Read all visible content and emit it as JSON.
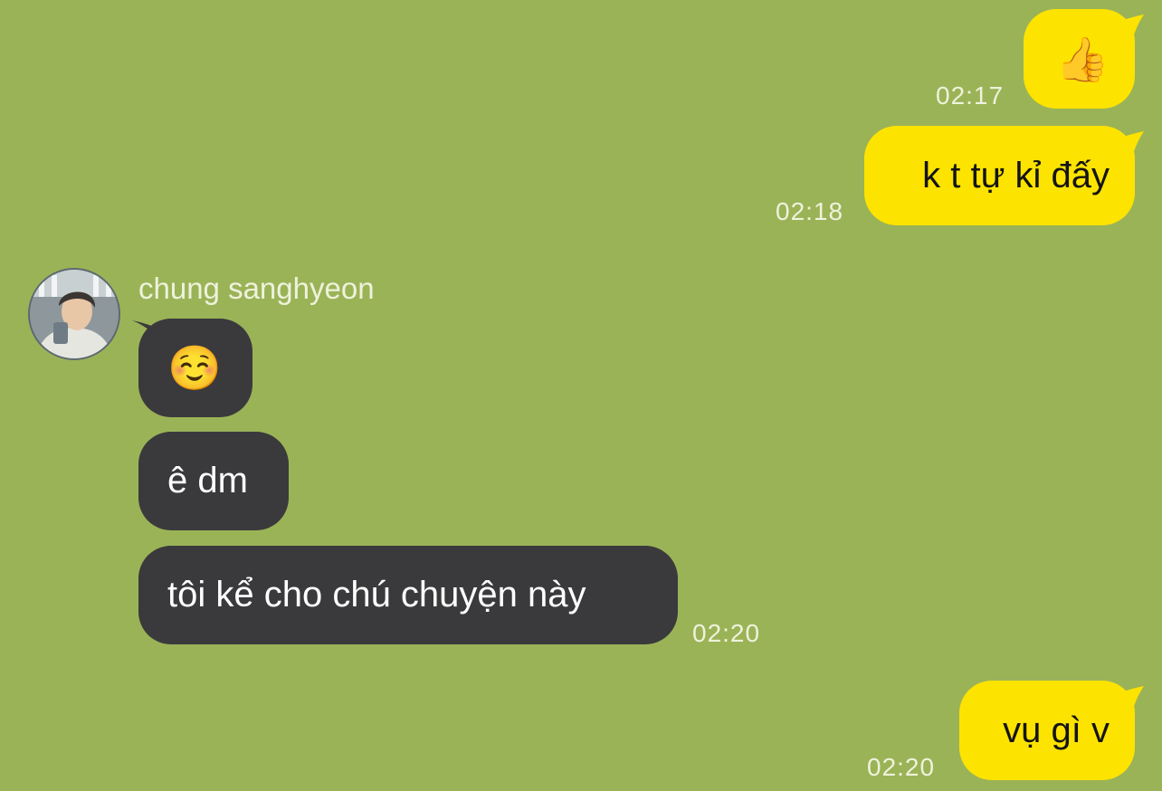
{
  "colors": {
    "background": "#9bb357",
    "outgoing_bubble": "#fde300",
    "outgoing_text": "#141414",
    "incoming_bubble": "#3a3a3c",
    "incoming_text": "#ffffff",
    "timestamp": "#eef2dc",
    "sender_name": "#eef2dc"
  },
  "messages": [
    {
      "direction": "outgoing",
      "text": "👍",
      "emoji": "thumbs-up",
      "time": "02:17"
    },
    {
      "direction": "outgoing",
      "text": "k t tự kỉ đấy",
      "time": "02:18"
    },
    {
      "direction": "incoming",
      "sender": "chung sanghyeon",
      "avatar": "profile-photo",
      "text": "☺️",
      "emoji": "smiling-face"
    },
    {
      "direction": "incoming",
      "text": "ê dm"
    },
    {
      "direction": "incoming",
      "text": "tôi kể cho chú chuyện này",
      "time": "02:20"
    },
    {
      "direction": "outgoing",
      "text": "vụ gì v",
      "time": "02:20"
    }
  ]
}
